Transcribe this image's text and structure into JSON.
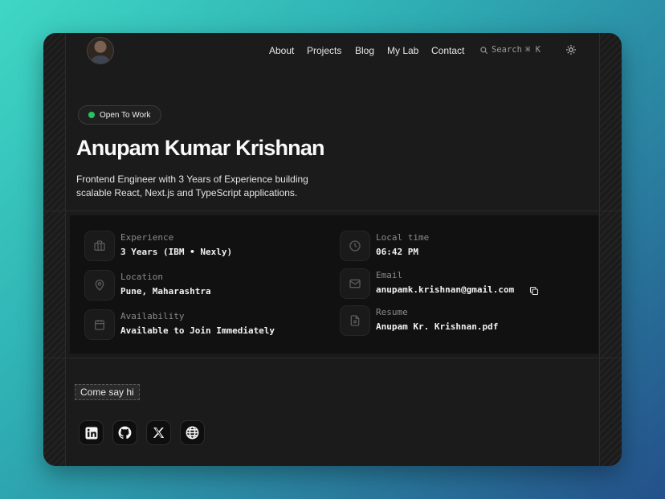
{
  "nav": {
    "links": [
      "About",
      "Projects",
      "Blog",
      "My Lab",
      "Contact"
    ],
    "search_label": "Search",
    "search_shortcut": "⌘ K",
    "theme_icon": "sun-icon"
  },
  "hero": {
    "status": "Open To Work",
    "name": "Anupam Kumar Krishnan",
    "bio": "Frontend Engineer with 3 Years of Experience building scalable React, Next.js and TypeScript applications."
  },
  "info": {
    "experience": {
      "label": "Experience",
      "value": "3 Years (IBM • Nexly)",
      "icon": "briefcase-icon"
    },
    "local_time": {
      "label": "Local time",
      "value": "06:42 PM",
      "icon": "clock-icon"
    },
    "location": {
      "label": "Location",
      "value": "Pune, Maharashtra",
      "icon": "map-pin-icon"
    },
    "email": {
      "label": "Email",
      "value": "anupamk.krishnan@gmail.com",
      "icon": "mail-icon"
    },
    "availability": {
      "label": "Availability",
      "value": "Available to Join Immediately",
      "icon": "calendar-icon"
    },
    "resume": {
      "label": "Resume",
      "value": "Anupam Kr. Krishnan.pdf",
      "icon": "file-icon"
    }
  },
  "contact": {
    "say_hi": "Come say hi",
    "socials": [
      "linkedin-icon",
      "github-icon",
      "x-icon",
      "globe-icon"
    ]
  },
  "colors": {
    "accent_status": "#22c55e",
    "background": "#1b1b1b",
    "panel": "#111111"
  }
}
